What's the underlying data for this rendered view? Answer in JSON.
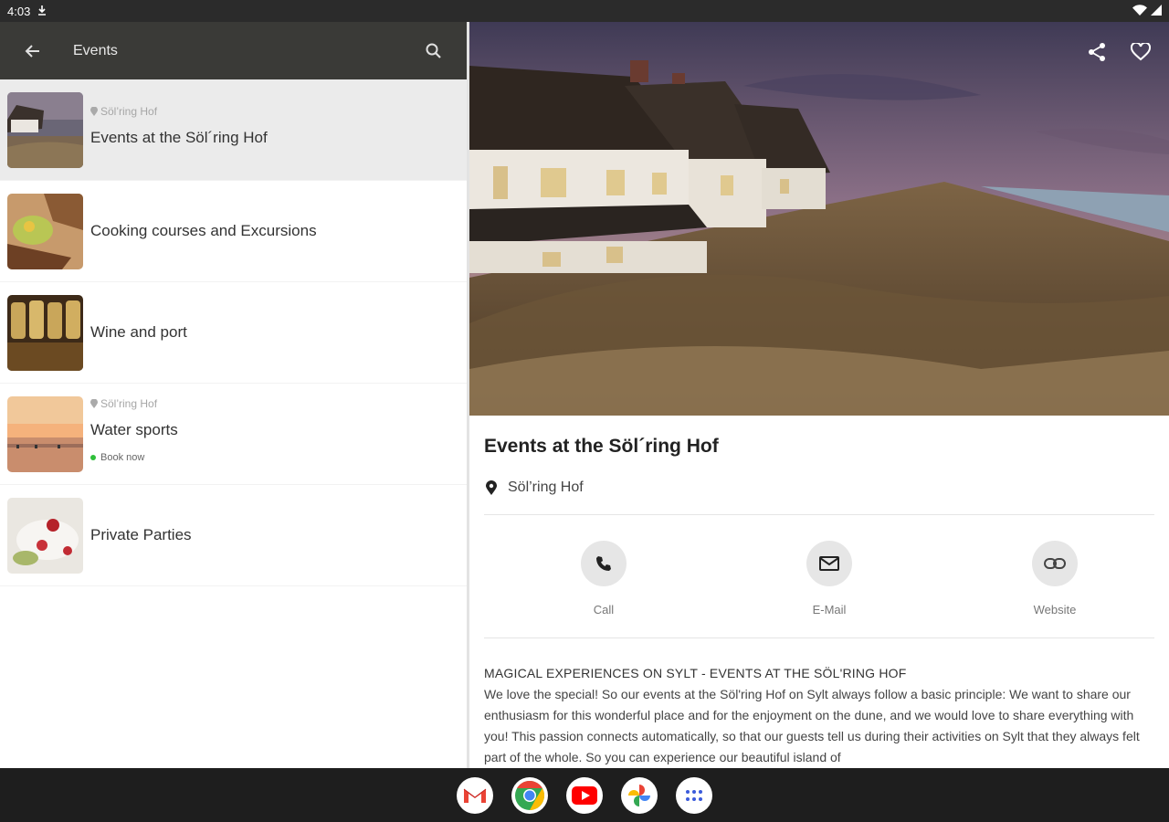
{
  "status_bar": {
    "time": "4:03"
  },
  "app_bar": {
    "title": "Events"
  },
  "list": [
    {
      "location": "Söl’ring Hof",
      "title": "Events at the Söl´ring Hof",
      "badge": ""
    },
    {
      "location": "",
      "title": "Cooking courses and Excursions",
      "badge": ""
    },
    {
      "location": "",
      "title": "Wine and port",
      "badge": ""
    },
    {
      "location": "Söl’ring Hof",
      "title": "Water sports",
      "badge": "Book now"
    },
    {
      "location": "",
      "title": "Private Parties",
      "badge": ""
    }
  ],
  "detail": {
    "title": "Events at the Söl´ring Hof",
    "location": "Söl’ring Hof",
    "actions": {
      "call": "Call",
      "email": "E-Mail",
      "website": "Website"
    },
    "description_heading": "MAGICAL EXPERIENCES ON SYLT - EVENTS AT THE SÖL'RING HOF",
    "description_body": "We love the special! So our events at the Söl'ring Hof on Sylt always follow a basic principle: We want to share our enthusiasm for this wonderful place and for the enjoyment on the dune, and we would love to share everything with you! This passion connects automatically, so that our guests tell us during their activities on Sylt that they always felt part of the whole. So you can experience our beautiful island of"
  },
  "colors": {
    "app_bar": "#3a3a37",
    "selected_row": "#ebebeb",
    "book_now_dot": "#2fbf3a",
    "action_circle": "#e6e6e6"
  },
  "icons": {
    "back": "arrow-back-icon",
    "search": "search-icon",
    "share": "share-icon",
    "favorite": "heart-icon",
    "location": "location-pin-icon",
    "call": "phone-icon",
    "email": "mail-icon",
    "website": "link-icon"
  },
  "dock": [
    "gmail-icon",
    "chrome-icon",
    "youtube-icon",
    "photos-icon",
    "app-drawer-icon"
  ]
}
